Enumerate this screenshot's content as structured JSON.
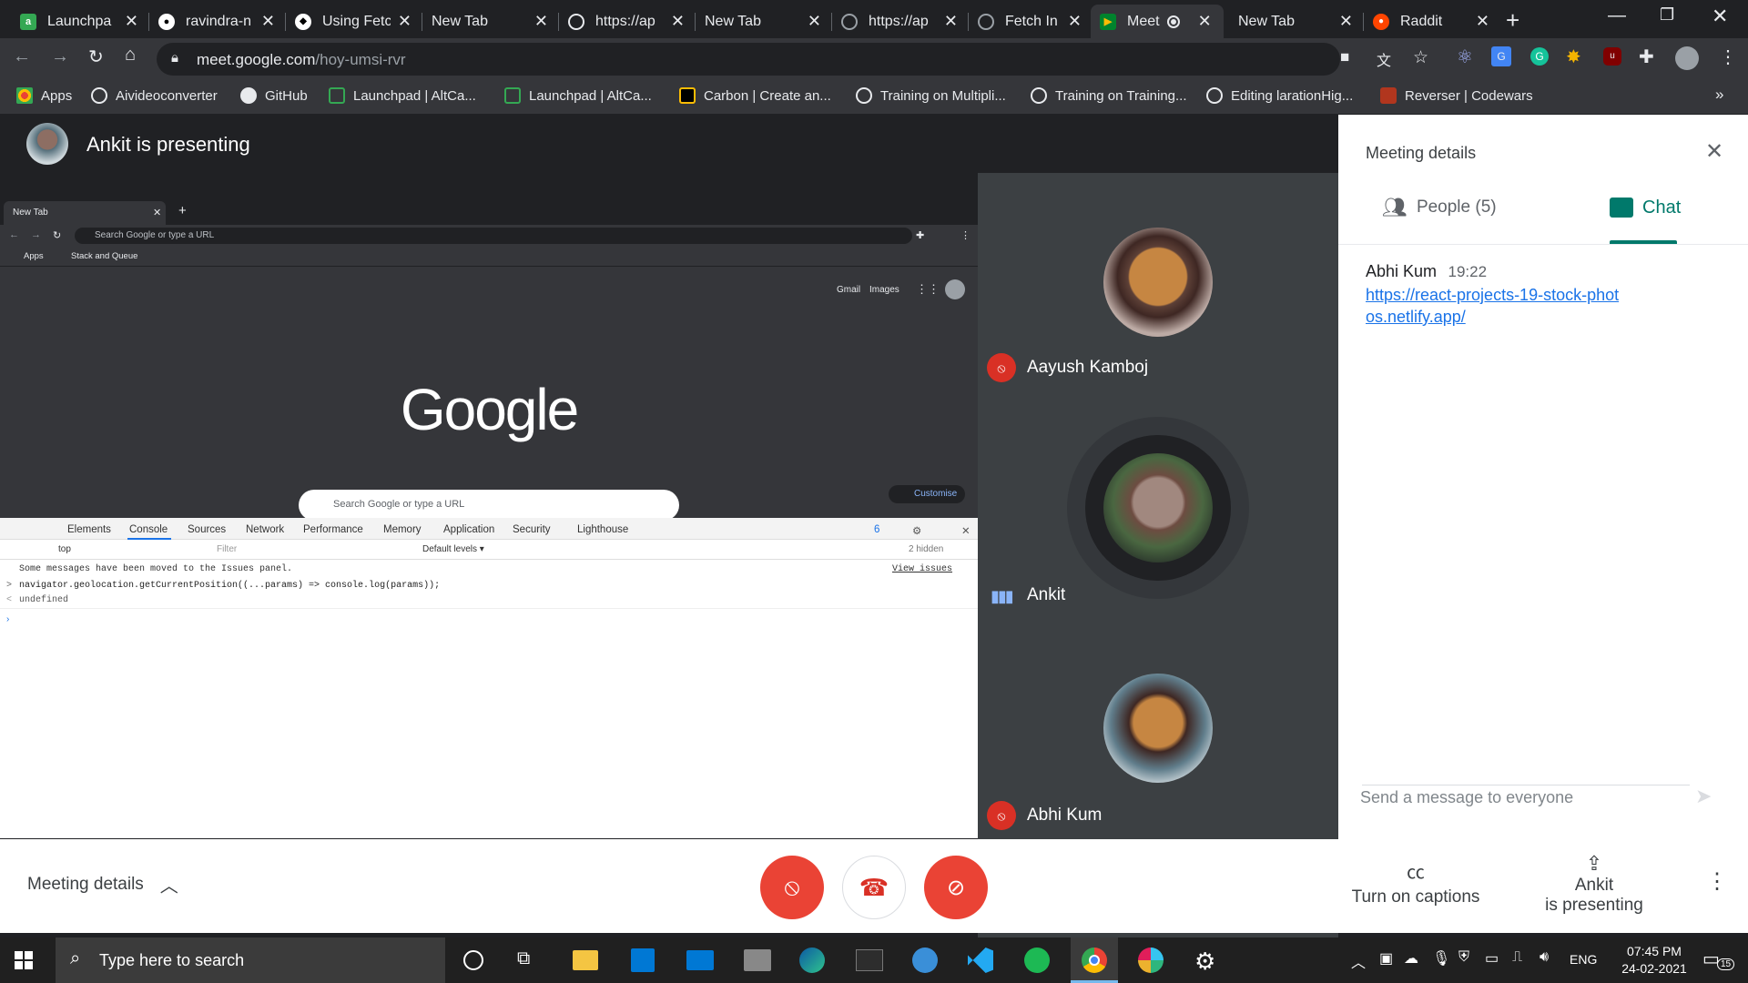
{
  "browser": {
    "tabs": [
      {
        "label": "Launchpa",
        "icon": "altcampus-icon",
        "color": "#34a853"
      },
      {
        "label": "ravindra-n",
        "icon": "github-icon",
        "color": "#ffffff"
      },
      {
        "label": "Using Fetc",
        "icon": "mdn-icon",
        "color": "#ffffff"
      },
      {
        "label": "New Tab",
        "icon": "",
        "color": ""
      },
      {
        "label": "https://ap",
        "icon": "globe-icon",
        "color": "#e8eaed"
      },
      {
        "label": "New Tab",
        "icon": "",
        "color": ""
      },
      {
        "label": "https://ap",
        "icon": "globe-icon",
        "color": "#9aa0a6"
      },
      {
        "label": "Fetch In p",
        "icon": "globe-icon",
        "color": "#9aa0a6"
      },
      {
        "label": "Meet",
        "icon": "meet-icon",
        "color": "#00832d",
        "active": true
      },
      {
        "label": "New Tab",
        "icon": "",
        "color": ""
      },
      {
        "label": "Raddit",
        "icon": "reddit-icon",
        "color": "#ff4500"
      }
    ],
    "url_host": "meet.google.com",
    "url_path": "/hoy-umsi-rvr",
    "bookmarks": [
      {
        "label": "Apps",
        "icon": "apps-grid-icon"
      },
      {
        "label": "Aivideoconverter",
        "icon": "globe-icon"
      },
      {
        "label": "GitHub",
        "icon": "github-icon"
      },
      {
        "label": "Launchpad | AltCa...",
        "icon": "altcampus-icon"
      },
      {
        "label": "Launchpad | AltCa...",
        "icon": "altcampus-icon"
      },
      {
        "label": "Carbon | Create an...",
        "icon": "carbon-icon"
      },
      {
        "label": "Training on Multipli...",
        "icon": "globe-icon"
      },
      {
        "label": "Training on Training...",
        "icon": "globe-icon"
      },
      {
        "label": "Editing larationHig...",
        "icon": "globe-icon"
      },
      {
        "label": "Reverser | Codewars",
        "icon": "codewars-icon"
      }
    ],
    "more_bookmarks": "»"
  },
  "meet": {
    "presenter_label": "Ankit is presenting",
    "participants": [
      {
        "name": "Aayush Kamboj",
        "muted": true
      },
      {
        "name": "Ankit",
        "muted": false,
        "speaking": true
      },
      {
        "name": "Abhi Kum",
        "muted": true
      }
    ],
    "panel": {
      "title": "Meeting details",
      "people_tab": "People (5)",
      "chat_tab": "Chat",
      "messages": [
        {
          "sender": "Abhi Kum",
          "time": "19:22",
          "text": "https://react-projects-19-stock-photos.netlify.app/"
        }
      ],
      "input_placeholder": "Send a message to everyone"
    },
    "bottom": {
      "meeting_details": "Meeting details",
      "captions": "Turn on captions",
      "presenting_line1": "Ankit",
      "presenting_line2": "is presenting"
    }
  },
  "shared_screen": {
    "tab_label": "New Tab",
    "omnibox_placeholder": "Search Google or type a URL",
    "bookmarks": [
      "Apps",
      "Stack and Queue"
    ],
    "top_links": [
      "Gmail",
      "Images"
    ],
    "logo": "Google",
    "search_placeholder": "Search Google or type a URL",
    "customise": "Customise",
    "devtools_tabs": [
      "Elements",
      "Console",
      "Sources",
      "Network",
      "Performance",
      "Memory",
      "Application",
      "Security",
      "Lighthouse"
    ],
    "devtools_active": "Console",
    "issue_count": "6",
    "context": "top",
    "filter_placeholder": "Filter",
    "levels": "Default levels ▾",
    "hidden": "2 hidden",
    "console_lines": [
      {
        "prefix": "",
        "text": "Some messages have been moved to the Issues panel."
      },
      {
        "prefix": ">",
        "text": "navigator.geolocation.getCurrentPosition((...params) => console.log(params));"
      },
      {
        "prefix": "<",
        "text": "undefined"
      }
    ],
    "view_issues": "View issues"
  },
  "taskbar": {
    "search_placeholder": "Type here to search",
    "lang": "ENG",
    "time": "07:45 PM",
    "date": "24-02-2021",
    "notifications": "15"
  }
}
